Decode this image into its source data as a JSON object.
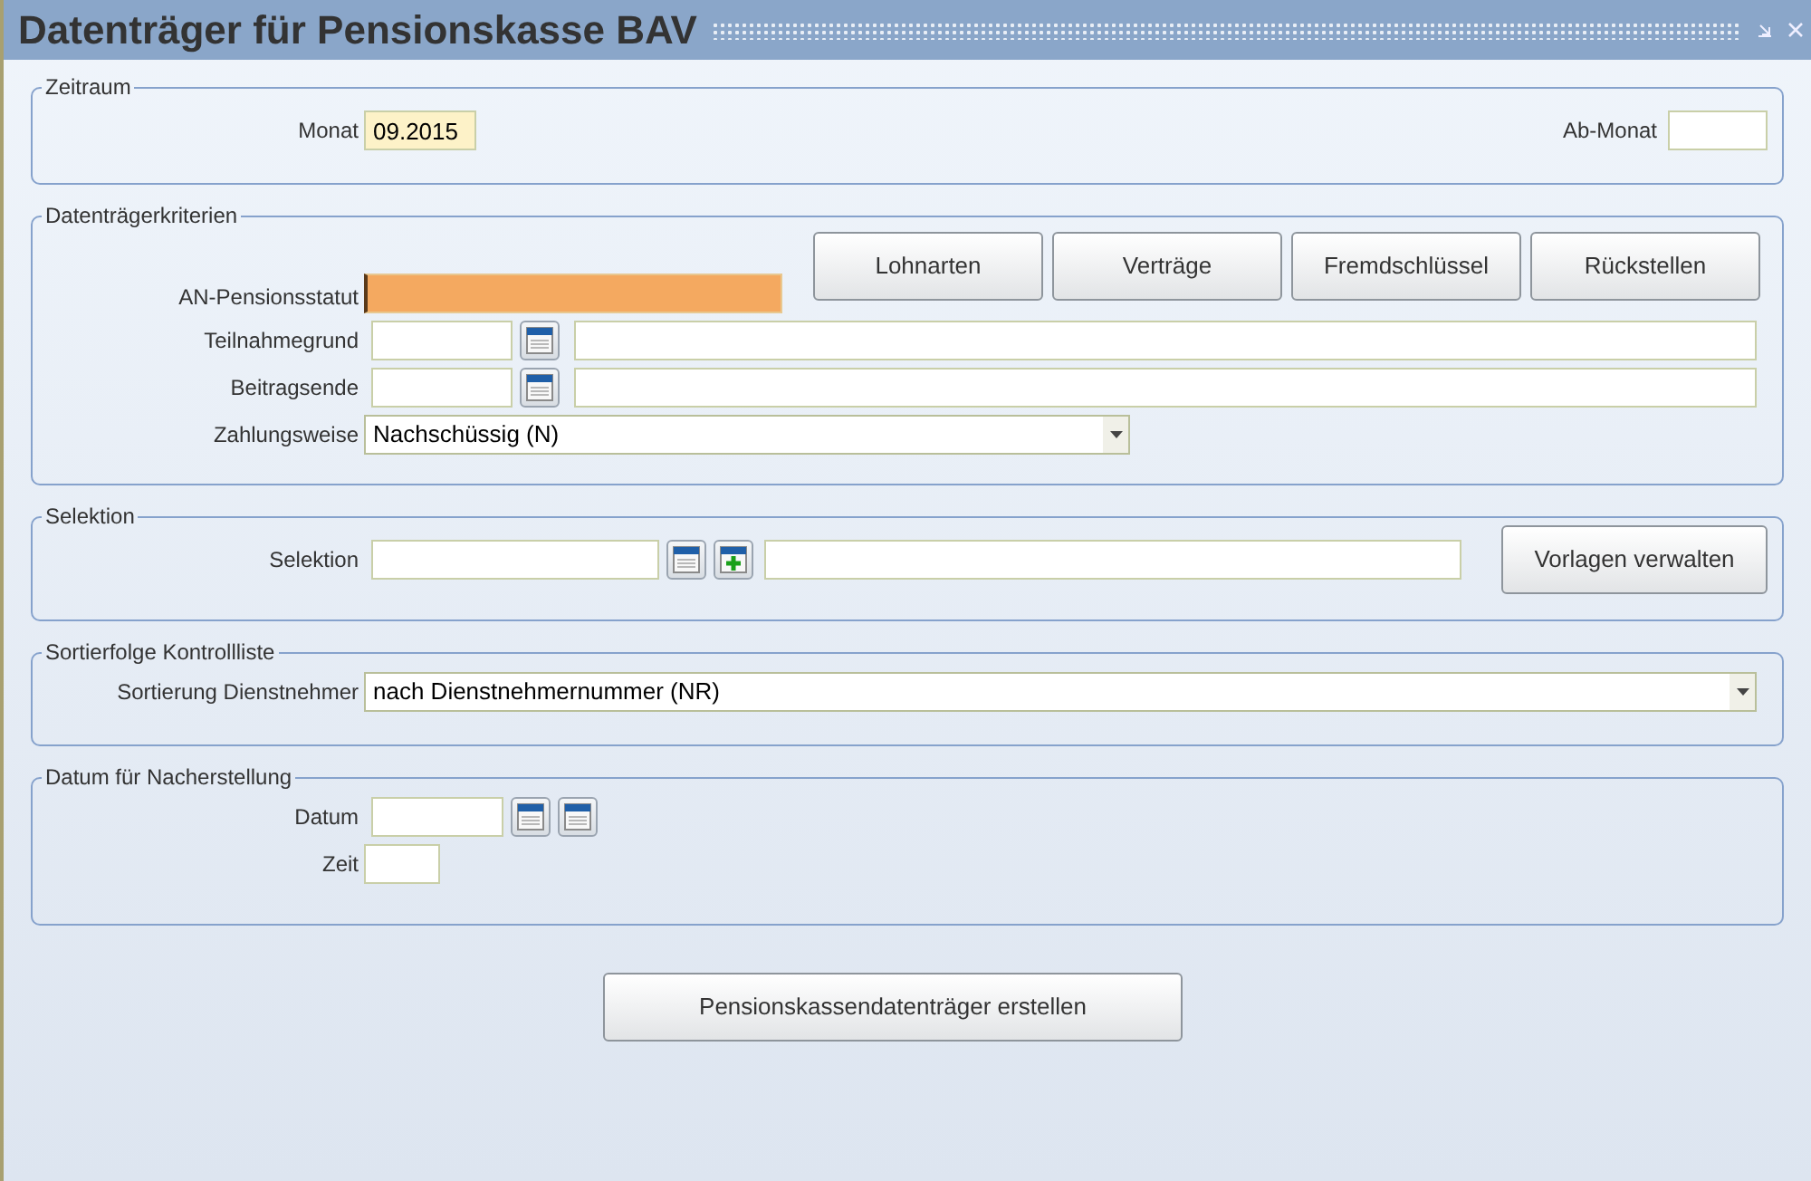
{
  "window": {
    "title": "Datenträger für Pensionskasse BAV"
  },
  "zeitraum": {
    "legend": "Zeitraum",
    "monat": {
      "label": "Monat",
      "value": "09.2015",
      "highlighted": true
    },
    "ab_monat": {
      "label": "Ab-Monat"
    }
  },
  "kriterien": {
    "legend": "Datenträgerkriterien",
    "buttons": [
      "Lohnarten",
      "Verträge",
      "Fremdschlüssel",
      "Rückstellen"
    ],
    "an_pensionsstatut": {
      "label": "AN-Pensionsstatut",
      "focused": true
    },
    "lookups": [
      {
        "label": "Teilnahmegrund"
      },
      {
        "label": "Beitragsende"
      }
    ],
    "zahlungsweise": {
      "label": "Zahlungsweise",
      "value": "Nachschüssig (N)"
    }
  },
  "selektion": {
    "legend": "Selektion",
    "label": "Selektion",
    "button": "Vorlagen verwalten"
  },
  "sortierfolge": {
    "legend": "Sortierfolge Kontrollliste",
    "label": "Sortierung Dienstnehmer",
    "value": "nach Dienstnehmernummer (NR)"
  },
  "nacherstellung": {
    "legend": "Datum für Nacherstellung",
    "datum": {
      "label": "Datum"
    },
    "zeit": {
      "label": "Zeit"
    }
  },
  "action_button": "Pensionskassendatenträger erstellen"
}
